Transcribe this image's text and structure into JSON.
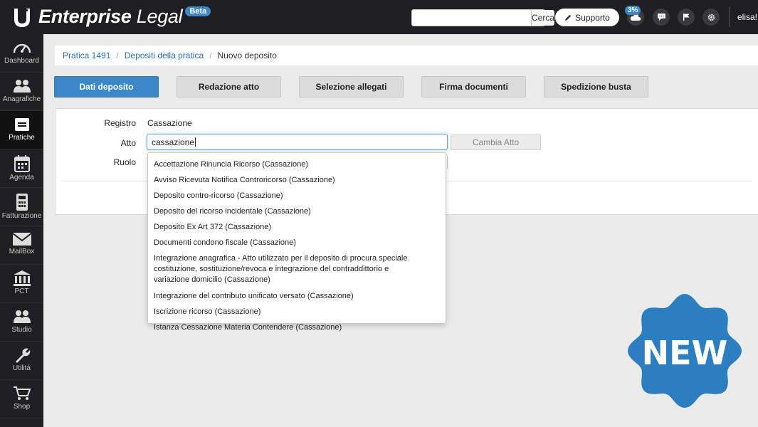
{
  "brand": {
    "name_bold": "Enterprise",
    "name_light": "Legal",
    "badge": "Beta"
  },
  "topbar": {
    "search_placeholder": "",
    "search_button": "Cerca",
    "support_label": "Supporto",
    "cloud_percent": "3%",
    "user": "elisa!"
  },
  "sidebar": {
    "items": [
      {
        "label": "Dashboard",
        "icon": "gauge-icon"
      },
      {
        "label": "Anagrafiche",
        "icon": "users-icon"
      },
      {
        "label": "Pratiche",
        "icon": "folder-icon"
      },
      {
        "label": "Agenda",
        "icon": "calendar-icon"
      },
      {
        "label": "Fatturazione",
        "icon": "calculator-icon"
      },
      {
        "label": "MailBox",
        "icon": "envelope-icon"
      },
      {
        "label": "PCT",
        "icon": "courthouse-icon"
      },
      {
        "label": "Studio",
        "icon": "users-icon"
      },
      {
        "label": "Utilità",
        "icon": "wrench-icon"
      },
      {
        "label": "Shop",
        "icon": "cart-icon"
      }
    ],
    "active_index": 2
  },
  "breadcrumb": {
    "items": [
      "Pratica 1491",
      "Depositi della pratica",
      "Nuovo deposito"
    ]
  },
  "steps": [
    "Dati deposito",
    "Redazione atto",
    "Selezione allegati",
    "Firma documenti",
    "Spedizione busta"
  ],
  "form": {
    "registro_label": "Registro",
    "registro_value": "Cassazione",
    "atto_label": "Atto",
    "atto_value": "cassazione",
    "cambia_button": "Cambia Atto",
    "ruolo_label": "Ruolo"
  },
  "dropdown": {
    "options": [
      "Accettazione Rinuncia Ricorso (Cassazione)",
      "Avviso Ricevuta Notifica Controricorso (Cassazione)",
      "Deposito contro-ricorso (Cassazione)",
      "Deposito del ricorso incidentale (Cassazione)",
      "Deposito Ex Art 372 (Cassazione)",
      "Documenti condono fiscale (Cassazione)",
      "Integrazione anagrafica - Atto utilizzato per il deposito di procura speciale costituzione, sostituzione/revoca e integrazione del contraddittorio e variazione domicilio (Cassazione)",
      "Integrazione del contributo unificato versato (Cassazione)",
      "Iscrizione ricorso (Cassazione)",
      "Istanza Cessazione Materia Contendere (Cassazione)"
    ]
  },
  "new_badge": "NEW",
  "colors": {
    "accent": "#3b87c8",
    "dark": "#1f1f21",
    "badge": "#2b7fc1"
  }
}
